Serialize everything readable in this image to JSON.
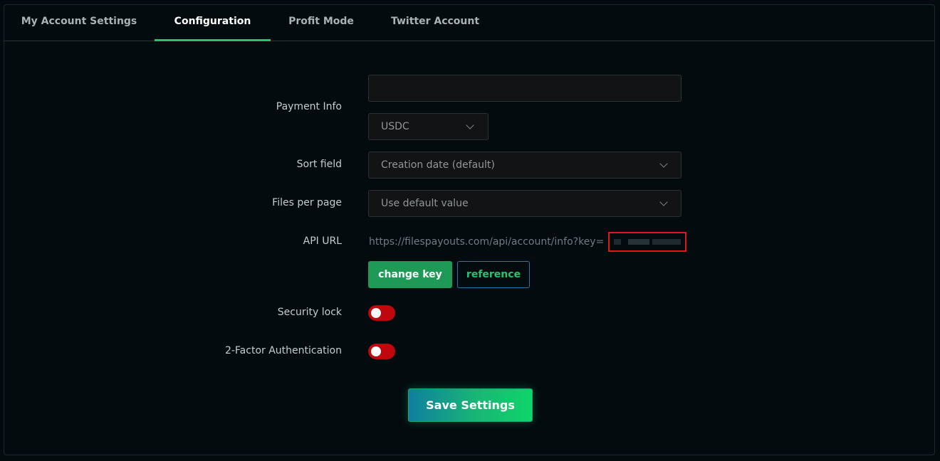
{
  "tabs": [
    {
      "label": "My Account Settings"
    },
    {
      "label": "Configuration",
      "active": true
    },
    {
      "label": "Profit Mode"
    },
    {
      "label": "Twitter Account"
    }
  ],
  "form": {
    "payment_info": {
      "label": "Payment Info",
      "value": "",
      "currency": "USDC"
    },
    "sort_field": {
      "label": "Sort field",
      "value": "Creation date (default)"
    },
    "files_per_page": {
      "label": "Files per page",
      "value": "Use default value"
    },
    "api_url": {
      "label": "API URL",
      "value": "https://filespayouts.com/api/account/info?key="
    },
    "change_key_label": "change key",
    "reference_label": "reference",
    "security_lock": {
      "label": "Security lock",
      "enabled": false
    },
    "two_factor": {
      "label": "2-Factor Authentication",
      "enabled": false
    },
    "save_label": "Save Settings"
  },
  "colors": {
    "accent": "#22c373",
    "toggle_off": "#c0070d",
    "highlight": "#e2161b"
  }
}
